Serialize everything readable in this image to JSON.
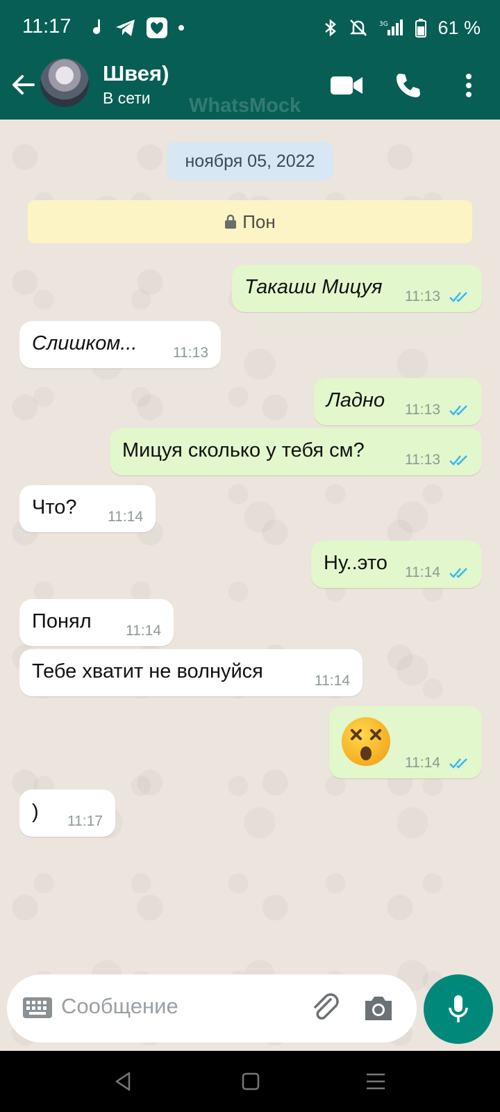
{
  "status_bar": {
    "time": "11:17",
    "battery": "61 %"
  },
  "header": {
    "name": "Швея)",
    "status": "В сети",
    "watermark": "WhatsMock"
  },
  "chat": {
    "date": "ноября 05, 2022",
    "encryption_note": "Пон",
    "messages": [
      {
        "dir": "out",
        "text": "Такаши Мицуя",
        "time": "11:13",
        "italic": true
      },
      {
        "dir": "in",
        "text": "Слишком...",
        "time": "11:13",
        "italic": true
      },
      {
        "dir": "out",
        "text": "Ладно",
        "time": "11:13",
        "italic": true
      },
      {
        "dir": "out",
        "text": "Мицуя сколько у тебя см?",
        "time": "11:13"
      },
      {
        "dir": "in",
        "text": "Что?",
        "time": "11:14"
      },
      {
        "dir": "out",
        "text": "Ну..это",
        "time": "11:14"
      },
      {
        "dir": "in",
        "text": "Понял",
        "time": "11:14"
      },
      {
        "dir": "in",
        "text": "Тебе хватит не волнуйся",
        "time": "11:14"
      },
      {
        "dir": "out",
        "emoji": "dizzy-face",
        "time": "11:14"
      },
      {
        "dir": "in",
        "text": ")",
        "time": "11:17"
      }
    ]
  },
  "composer": {
    "placeholder": "Сообщение"
  },
  "colors": {
    "header": "#075e54",
    "outgoing": "#e2f7cb",
    "incoming": "#ffffff",
    "read_ticks": "#34b7f1",
    "mic": "#00897b"
  }
}
